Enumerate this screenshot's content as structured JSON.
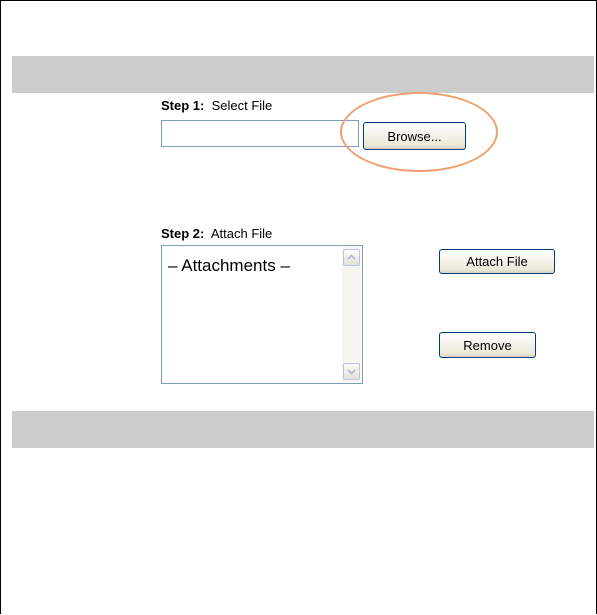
{
  "step1": {
    "number": "Step 1:",
    "text": "Select File"
  },
  "file_input": {
    "value": ""
  },
  "browse_button": {
    "label": "Browse..."
  },
  "step2": {
    "number": "Step 2:",
    "text": "Attach File"
  },
  "attachments": {
    "items": [
      "– Attachments –"
    ]
  },
  "attach_button": {
    "label": "Attach File"
  },
  "remove_button": {
    "label": "Remove"
  },
  "colors": {
    "band": "#cccccc",
    "highlight": "#f0a070",
    "input_border": "#7f9db9"
  },
  "icons": {
    "scroll_up": "chevron-up-icon",
    "scroll_down": "chevron-down-icon"
  }
}
